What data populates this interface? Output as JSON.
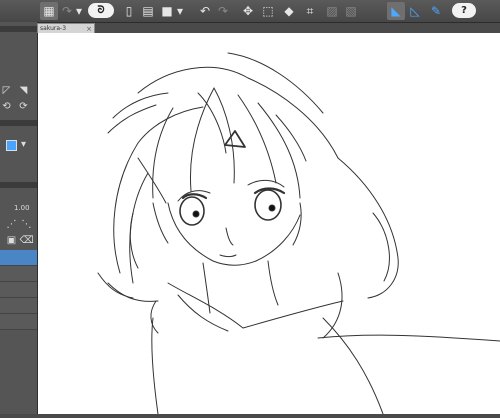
{
  "toolbar": {
    "icons": [
      "layout-icon",
      "redo-icon",
      "dropdown-icon",
      "brand-icon",
      "new-file-icon",
      "open-file-icon",
      "save-icon",
      "save-dropdown-icon",
      "undo-icon",
      "redo-arrow-icon",
      "transform-icon",
      "select-icon",
      "fill-icon",
      "crop-icon",
      "clear-icon",
      "deselect-icon",
      "ruler-icon",
      "ruler-guide-icon",
      "pen-icon",
      "help-icon"
    ],
    "help_label": "?"
  },
  "document": {
    "tab_title": "sakura-3"
  },
  "left_panel": {
    "brush_size": "1.00"
  },
  "canvas": {
    "background": "#ffffff",
    "stroke_color": "#333333"
  }
}
